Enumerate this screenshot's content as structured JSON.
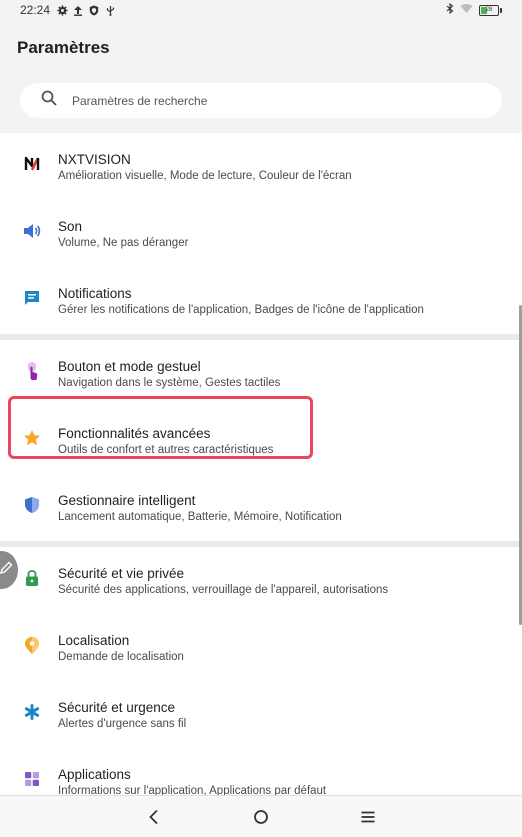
{
  "status_bar": {
    "time": "22:24",
    "battery_level": "28",
    "icons": [
      "gear-icon",
      "upload-icon",
      "shield-icon",
      "usb-icon",
      "bluetooth-icon",
      "wifi-icon",
      "battery-icon"
    ]
  },
  "header": {
    "title": "Paramètres"
  },
  "search": {
    "placeholder": "Paramètres de recherche",
    "icon": "search-icon"
  },
  "settings": {
    "nxtvision": {
      "title": "NXTVISION",
      "subtitle": "Amélioration visuelle, Mode de lecture, Couleur de l'écran",
      "icon": "nxtvision-icon",
      "color": "#e53935"
    },
    "son": {
      "title": "Son",
      "subtitle": "Volume, Ne pas déranger",
      "icon": "speaker-icon",
      "color": "#3f6fcf"
    },
    "notifications": {
      "title": "Notifications",
      "subtitle": "Gérer les notifications de l'application, Badges de l'icône de l'application",
      "icon": "message-icon",
      "color": "#1e88c7"
    },
    "bouton": {
      "title": "Bouton et mode gestuel",
      "subtitle": "Navigation dans le système, Gestes tactiles",
      "icon": "gesture-icon",
      "color": "#8e24aa"
    },
    "fonctionnalites": {
      "title": "Fonctionnalités avancées",
      "subtitle": "Outils de confort et autres caractéristiques",
      "icon": "star-icon",
      "color": "#f5a623"
    },
    "gestionnaire": {
      "title": "Gestionnaire intelligent",
      "subtitle": "Lancement automatique, Batterie, Mémoire, Notification",
      "icon": "shield-icon",
      "color": "#3f6fcf"
    },
    "securite": {
      "title": "Sécurité et vie privée",
      "subtitle": "Sécurité des applications, verrouillage de l'appareil, autorisations",
      "icon": "lock-icon",
      "color": "#2e9a4a"
    },
    "localisation": {
      "title": "Localisation",
      "subtitle": "Demande de localisation",
      "icon": "location-pin-icon",
      "color": "#f5a623"
    },
    "urgence": {
      "title": "Sécurité et urgence",
      "subtitle": "Alertes d'urgence sans fil",
      "icon": "asterisk-icon",
      "color": "#1e88c7"
    },
    "applications": {
      "title": "Applications",
      "subtitle": "Informations sur l'application, Applications par défaut",
      "icon": "apps-grid-icon",
      "color": "#7e57c2"
    }
  },
  "highlight_color": "#e8475e",
  "nav_bar": {
    "icons": [
      "back-icon",
      "home-icon",
      "menu-icon"
    ]
  }
}
